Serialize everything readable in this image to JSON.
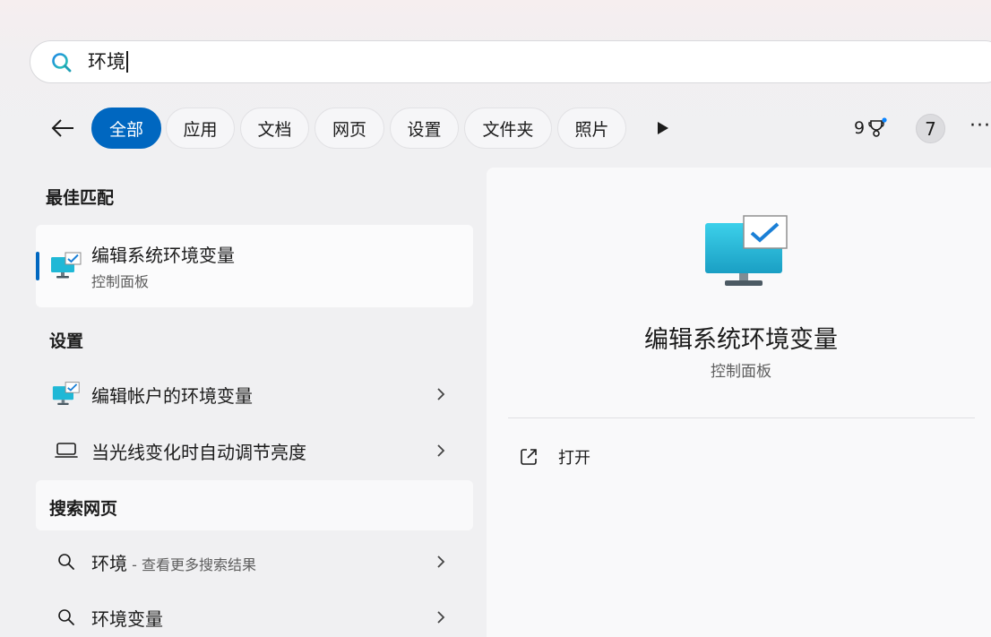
{
  "search": {
    "query": "环境"
  },
  "filters": {
    "back": "back-arrow-icon",
    "chips": [
      {
        "label": "全部",
        "active": true
      },
      {
        "label": "应用",
        "active": false
      },
      {
        "label": "文档",
        "active": false
      },
      {
        "label": "网页",
        "active": false
      },
      {
        "label": "设置",
        "active": false
      },
      {
        "label": "文件夹",
        "active": false
      },
      {
        "label": "照片",
        "active": false
      }
    ],
    "more_chips": "play-icon",
    "points": "9",
    "avatar_letter": "7",
    "more": "···"
  },
  "best_match": {
    "section_title": "最佳匹配",
    "title": "编辑系统环境变量",
    "subtitle": "控制面板"
  },
  "settings": {
    "section_title": "设置",
    "items": [
      {
        "label": "编辑帐户的环境变量",
        "icon": "monitor-check-icon"
      },
      {
        "label": "当光线变化时自动调节亮度",
        "icon": "laptop-icon"
      }
    ]
  },
  "web": {
    "section_title": "搜索网页",
    "items": [
      {
        "label": "环境",
        "hint": " - 查看更多搜索结果"
      },
      {
        "label": "环境变量",
        "hint": ""
      }
    ]
  },
  "detail": {
    "title": "编辑系统环境变量",
    "subtitle": "控制面板",
    "actions": [
      {
        "label": "打开",
        "icon": "open-external-icon"
      }
    ]
  },
  "colors": {
    "accent": "#0067c0",
    "monitor": "#20b8d6"
  }
}
